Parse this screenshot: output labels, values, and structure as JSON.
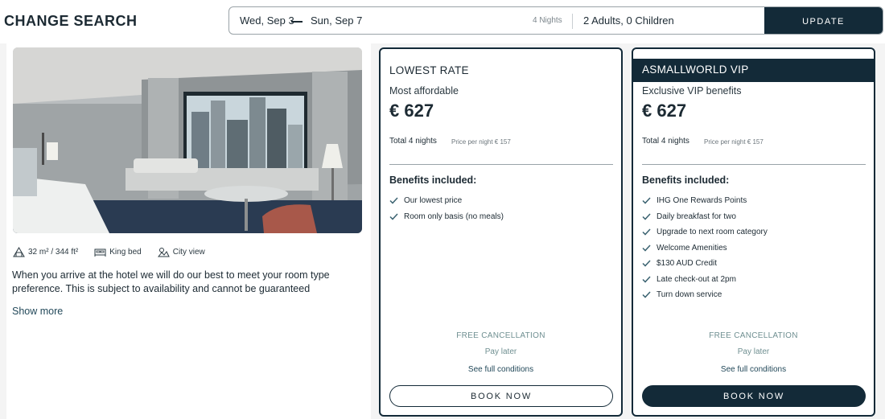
{
  "header": {
    "change_search": "CHANGE SEARCH",
    "check_in": "Wed, Sep 3",
    "check_out": "Sun, Sep 7",
    "nights": "4 Nights",
    "guests": "2 Adults, 0 Children",
    "update_label": "UPDATE"
  },
  "room": {
    "features": [
      {
        "icon": "room-size-icon",
        "label": "32 m² / 344 ft²"
      },
      {
        "icon": "bed-icon",
        "label": "King bed"
      },
      {
        "icon": "city-view-icon",
        "label": "City view"
      }
    ],
    "description": "When you arrive at the hotel we will do our best to meet your room type preference. This is subject to availability and cannot be guaranteed",
    "show_more": "Show more"
  },
  "rates": [
    {
      "title": "LOWEST RATE",
      "subtitle": "Most affordable",
      "price": "€ 627",
      "total": "Total 4 nights",
      "per_night": "Price per night € 157",
      "benefits_title": "Benefits included:",
      "benefits": [
        "Our lowest price",
        "Room only basis (no meals)"
      ],
      "free_cancellation": "FREE CANCELLATION",
      "pay_later": "Pay later",
      "full_conditions": "See full conditions",
      "book_label": "BOOK NOW"
    },
    {
      "title": "ASMALLWORLD VIP",
      "subtitle": "Exclusive VIP benefits",
      "price": "€ 627",
      "total": "Total 4 nights",
      "per_night": "Price per night € 157",
      "benefits_title": "Benefits included:",
      "benefits": [
        "IHG One Rewards Points",
        "Daily breakfast for two",
        "Upgrade to next room category",
        "Welcome Amenities",
        "$130 AUD Credit",
        "Late check-out at 2pm",
        "Turn down service"
      ],
      "free_cancellation": "FREE CANCELLATION",
      "pay_later": "Pay later",
      "full_conditions": "See full conditions",
      "book_label": "BOOK NOW"
    }
  ],
  "colors": {
    "navy": "#132a38",
    "teal_text": "#6f8f91",
    "background": "#f4f4f4"
  }
}
